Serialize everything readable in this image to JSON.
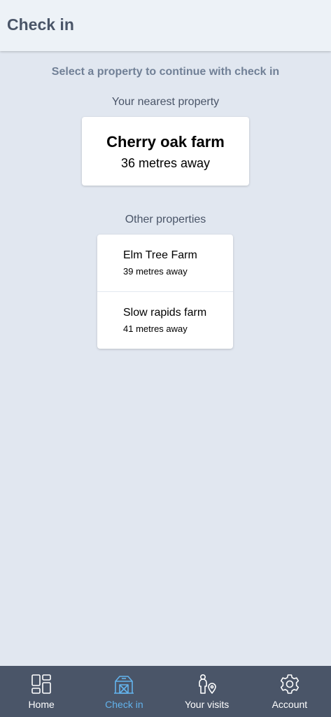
{
  "header": {
    "title": "Check in"
  },
  "instruction": "Select a property to continue with check in",
  "nearest": {
    "label": "Your nearest property",
    "name": "Cherry oak farm",
    "distance": "36 metres away"
  },
  "others": {
    "label": "Other properties",
    "items": [
      {
        "name": "Elm Tree Farm",
        "distance": "39 metres away"
      },
      {
        "name": "Slow rapids farm",
        "distance": "41 metres away"
      }
    ]
  },
  "nav": {
    "active": "check-in",
    "items": [
      {
        "label": "Home",
        "icon": "grid-icon"
      },
      {
        "label": "Check in",
        "icon": "barn-icon"
      },
      {
        "label": "Your visits",
        "icon": "person-location-icon"
      },
      {
        "label": "Account",
        "icon": "gear-icon"
      }
    ]
  },
  "colors": {
    "background": "#e1e7f0",
    "header_bg": "#edf2f7",
    "nav_bg": "#4a5568",
    "nav_active": "#63b3ed",
    "muted_text": "#718096"
  }
}
